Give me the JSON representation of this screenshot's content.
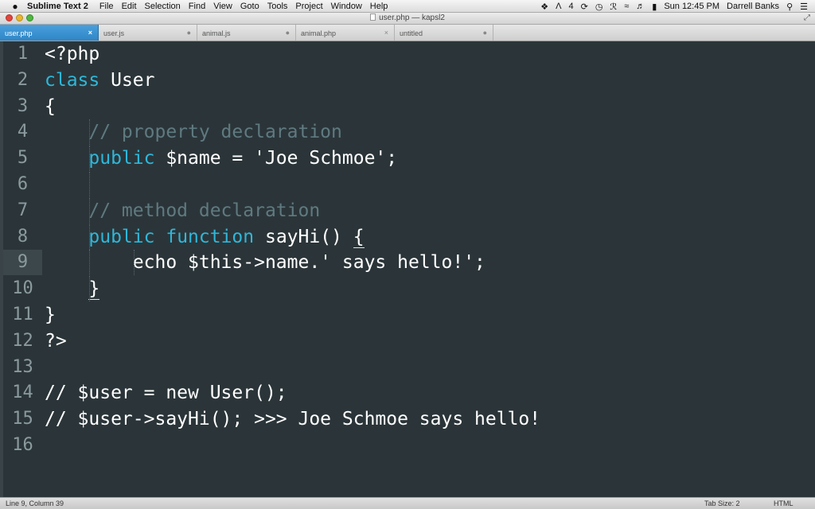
{
  "menubar": {
    "apple": "",
    "app_name": "Sublime Text 2",
    "menus": [
      "File",
      "Edit",
      "Selection",
      "Find",
      "View",
      "Goto",
      "Tools",
      "Project",
      "Window",
      "Help"
    ],
    "tray_count": "4",
    "clock": "Sun 12:45 PM",
    "user": "Darrell Banks"
  },
  "window": {
    "title": "user.php — kapsl2"
  },
  "tabs": [
    {
      "label": "user.php",
      "active": true,
      "close": "×"
    },
    {
      "label": "user.js",
      "active": false,
      "close": "●"
    },
    {
      "label": "animal.js",
      "active": false,
      "close": "●"
    },
    {
      "label": "animal.php",
      "active": false,
      "close": "×"
    },
    {
      "label": "untitled",
      "active": false,
      "close": "●"
    }
  ],
  "editor": {
    "current_line": 9,
    "lines": [
      {
        "n": "1",
        "segments": [
          {
            "t": "<?php",
            "c": "plain"
          }
        ]
      },
      {
        "n": "2",
        "segments": [
          {
            "t": "class",
            "c": "kw"
          },
          {
            "t": " User",
            "c": "plain"
          }
        ]
      },
      {
        "n": "3",
        "segments": [
          {
            "t": "{",
            "c": "plain"
          }
        ]
      },
      {
        "n": "4",
        "segments": [
          {
            "t": "    // property declaration",
            "c": "cm"
          }
        ]
      },
      {
        "n": "5",
        "segments": [
          {
            "t": "    ",
            "c": "plain"
          },
          {
            "t": "public",
            "c": "kw"
          },
          {
            "t": " $name = 'Joe Schmoe';",
            "c": "plain"
          }
        ]
      },
      {
        "n": "6",
        "segments": []
      },
      {
        "n": "7",
        "segments": [
          {
            "t": "    // method declaration",
            "c": "cm"
          }
        ]
      },
      {
        "n": "8",
        "segments": [
          {
            "t": "    ",
            "c": "plain"
          },
          {
            "t": "public",
            "c": "kw"
          },
          {
            "t": " ",
            "c": "plain"
          },
          {
            "t": "function",
            "c": "kw"
          },
          {
            "t": " sayHi() ",
            "c": "plain"
          },
          {
            "t": "{",
            "c": "match"
          }
        ]
      },
      {
        "n": "9",
        "segments": [
          {
            "t": "        echo $this->name.' says hello!';",
            "c": "plain"
          }
        ]
      },
      {
        "n": "10",
        "segments": [
          {
            "t": "    ",
            "c": "plain"
          },
          {
            "t": "}",
            "c": "match"
          }
        ]
      },
      {
        "n": "11",
        "segments": [
          {
            "t": "}",
            "c": "plain"
          }
        ]
      },
      {
        "n": "12",
        "segments": [
          {
            "t": "?>",
            "c": "plain"
          }
        ]
      },
      {
        "n": "13",
        "segments": []
      },
      {
        "n": "14",
        "segments": [
          {
            "t": "// $user = new User();",
            "c": "plain"
          }
        ]
      },
      {
        "n": "15",
        "segments": [
          {
            "t": "// $user->sayHi(); >>> Joe Schmoe says hello!",
            "c": "plain"
          }
        ]
      },
      {
        "n": "16",
        "segments": []
      }
    ]
  },
  "statusbar": {
    "position": "Line 9, Column 39",
    "tab_size": "Tab Size: 2",
    "syntax": "HTML"
  },
  "colors": {
    "background": "#2b3539",
    "keyword": "#2fb7d9",
    "comment": "#5f7a80",
    "text": "#ffffff",
    "active_tab": "#3a92d0"
  }
}
